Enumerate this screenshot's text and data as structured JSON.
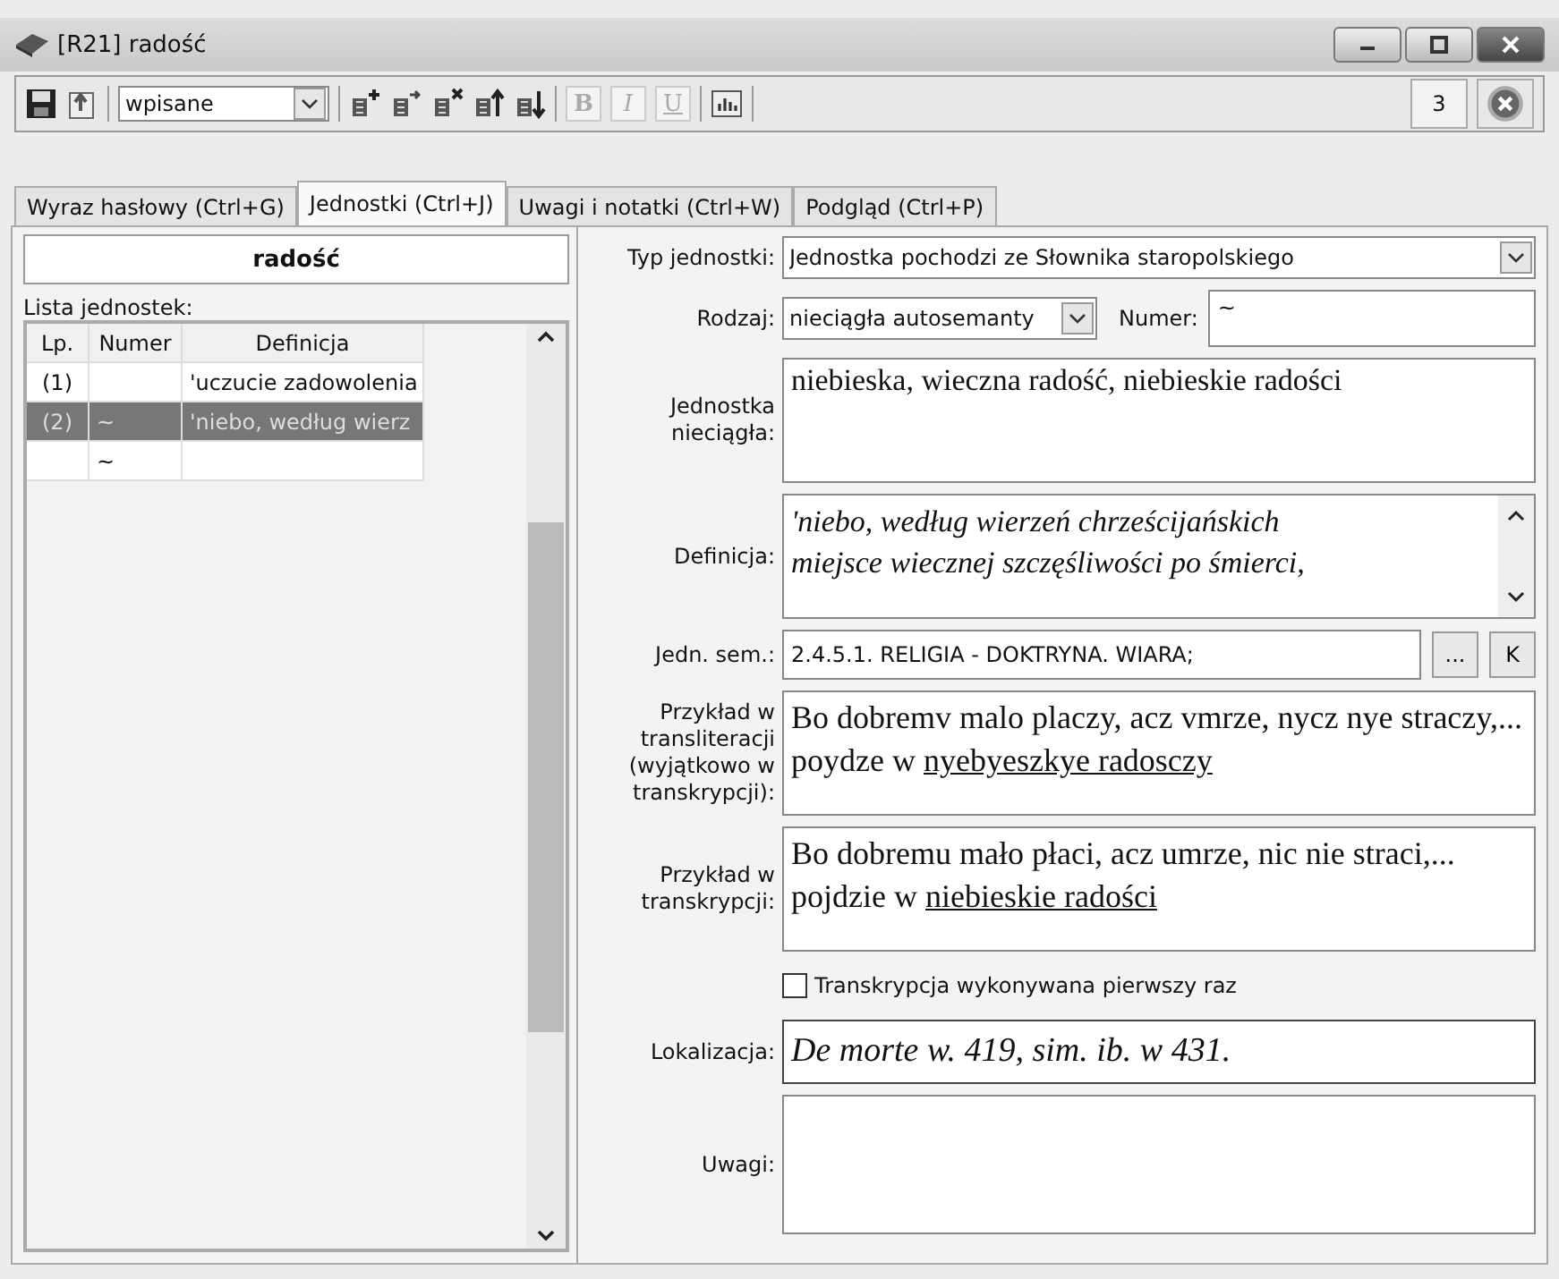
{
  "window": {
    "title": "[R21] radość"
  },
  "toolbar": {
    "mode": "wpisane",
    "format_buttons": [
      {
        "label": "B",
        "disabled": true
      },
      {
        "label": "I",
        "disabled": true
      },
      {
        "label": "U",
        "disabled": true
      }
    ],
    "counter": "3"
  },
  "tabs": [
    {
      "label": "Wyraz hasłowy (Ctrl+G)",
      "selected": false
    },
    {
      "label": "Jednostki (Ctrl+J)",
      "selected": true
    },
    {
      "label": "Uwagi i notatki (Ctrl+W)",
      "selected": false
    },
    {
      "label": "Podgląd (Ctrl+P)",
      "selected": false
    }
  ],
  "headword": "radość",
  "unit_list": {
    "label": "Lista jednostek:",
    "columns": [
      "Lp.",
      "Numer",
      "Definicja"
    ],
    "rows": [
      {
        "cells": [
          "(1)",
          "",
          "'uczucie zadowolenia"
        ],
        "selected": false
      },
      {
        "cells": [
          "(2)",
          "~",
          "'niebo, według wierz"
        ],
        "selected": true
      },
      {
        "cells": [
          "",
          "~",
          ""
        ],
        "selected": false
      }
    ]
  },
  "form": {
    "type": {
      "label": "Typ jednostki:",
      "value": "Jednostka pochodzi ze Słownika staropolskiego"
    },
    "kind": {
      "label": "Rodzaj:",
      "value": "nieciągła autosemanty"
    },
    "number": {
      "label": "Numer:",
      "value": "~"
    },
    "discontinuous": {
      "label": "Jednostka nieciągła:",
      "value": "niebieska, wieczna radość, niebieskie radości"
    },
    "definition": {
      "label": "Definicja:",
      "lines": [
        "'niebo, według wierzeń chrześcijańskich",
        "miejsce wiecznej szczęśliwości po śmierci,"
      ]
    },
    "semantic": {
      "label": "Jedn. sem.:",
      "value": "2.4.5.1. RELIGIA - DOKTRYNA. WIARA;",
      "buttons": [
        "...",
        "K"
      ]
    },
    "transliteration": {
      "label": "Przykład w transliteracji (wyjątkowo w transkrypcji):",
      "segments": [
        {
          "text": "Bo dobremv malo placzy, acz vmrze, nycz nye straczy,... poydze w ",
          "underline": false
        },
        {
          "text": "nyebyeszkye radosczy",
          "underline": true
        }
      ]
    },
    "transcription": {
      "label": "Przykład w transkrypcji:",
      "segments": [
        {
          "text": "Bo dobremu mało płaci, acz umrze, nic nie straci,... pojdzie w ",
          "underline": false
        },
        {
          "text": "niebieskie radości",
          "underline": true
        }
      ]
    },
    "first_time": {
      "label": "Transkrypcja wykonywana pierwszy raz",
      "checked": false
    },
    "location": {
      "label": "Lokalizacja:",
      "value": "De morte w. 419, sim. ib. w 431."
    },
    "notes": {
      "label": "Uwagi:"
    }
  }
}
